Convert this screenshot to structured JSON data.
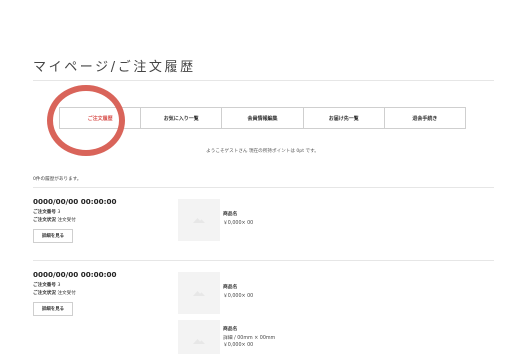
{
  "page": {
    "title": "マイページ/ご注文履歴"
  },
  "tabs": [
    {
      "label": "ご注文履歴",
      "active": true
    },
    {
      "label": "お気に入り一覧",
      "active": false
    },
    {
      "label": "会員情報編集",
      "active": false
    },
    {
      "label": "お届け先一覧",
      "active": false
    },
    {
      "label": "退会手続き",
      "active": false
    }
  ],
  "welcome_text": "ようこそゲストさん 現在の所持ポイントは 0pt です。",
  "result_count": "0件の履歴があります。",
  "orders": [
    {
      "date": "0000/00/00 00:00:00",
      "order_no_label": "ご注文番号",
      "order_no": "3",
      "status_label": "ご注文状況",
      "status": "注文受付",
      "detail_button": "詳細を見る",
      "items": [
        {
          "name": "商品名",
          "price": "￥0,000× 00"
        }
      ]
    },
    {
      "date": "0000/00/00 00:00:00",
      "order_no_label": "ご注文番号",
      "order_no": "3",
      "status_label": "ご注文状況",
      "status": "注文受付",
      "detail_button": "詳細を見る",
      "items": [
        {
          "name": "商品名",
          "price": "￥0,000× 00"
        },
        {
          "name": "商品名",
          "spec": "詳細 / 00mm × 00mm",
          "price": "￥0,000× 00"
        }
      ]
    }
  ],
  "colors": {
    "accent": "#d9534f",
    "ring": "#d9645a",
    "border": "#cfcfcf",
    "thumb_bg": "#f3f3f3"
  },
  "icons": {
    "product_placeholder": "mountain-image-icon"
  }
}
